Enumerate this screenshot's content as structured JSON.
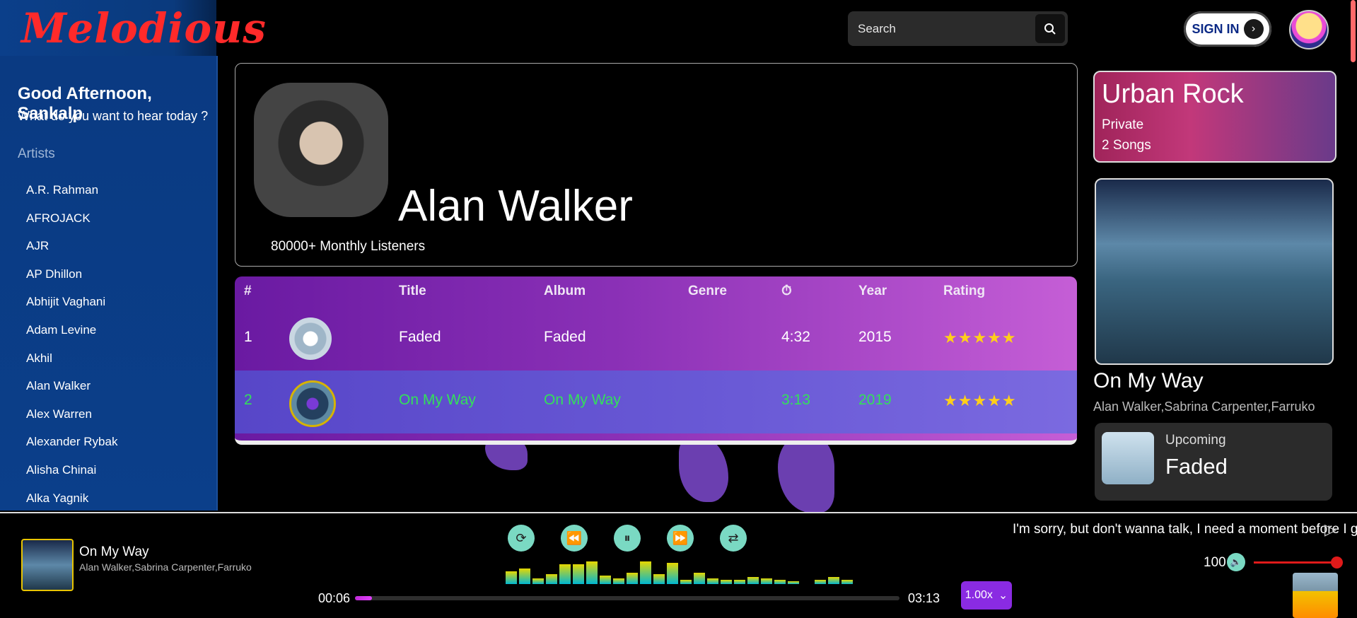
{
  "app": {
    "logo": "Melodious"
  },
  "header": {
    "search_placeholder": "Search",
    "signin_label": "SIGN IN"
  },
  "sidebar": {
    "greeting": "Good Afternoon, Sankalp",
    "subgreeting": "What do you want to hear today ?",
    "section_label": "Artists",
    "artists": [
      "A.R. Rahman",
      "AFROJACK",
      "AJR",
      "AP Dhillon",
      "Abhijit Vaghani",
      "Adam Levine",
      "Akhil",
      "Alan Walker",
      "Alex Warren",
      "Alexander Rybak",
      "Alisha Chinai",
      "Alka Yagnik"
    ]
  },
  "artist": {
    "name": "Alan Walker",
    "listeners": "80000+ Monthly Listeners"
  },
  "table": {
    "headers": {
      "num": "#",
      "title": "Title",
      "album": "Album",
      "genre": "Genre",
      "duration": "⏱",
      "year": "Year",
      "rating": "Rating"
    },
    "rows": [
      {
        "num": "1",
        "title": "Faded",
        "album": "Faded",
        "genre": "",
        "duration": "4:32",
        "year": "2015",
        "rating": 5
      },
      {
        "num": "2",
        "title": "On My Way",
        "album": "On My Way",
        "genre": "",
        "duration": "3:13",
        "year": "2019",
        "rating": 5
      }
    ]
  },
  "right": {
    "playlist": {
      "title": "Urban Rock",
      "visibility": "Private",
      "count": "2 Songs"
    },
    "now_playing": {
      "title": "On My Way",
      "artists": "Alan Walker,Sabrina Carpenter,Farruko"
    },
    "upcoming": {
      "label": "Upcoming",
      "title": "Faded"
    }
  },
  "player": {
    "title": "On My Way",
    "artists": "Alan Walker,Sabrina Carpenter,Farruko",
    "elapsed": "00:06",
    "total": "03:13",
    "progress": 0.031,
    "speed": "1.00x",
    "lyric": "I'm sorry, but don't wanna talk, I need a moment before I go",
    "volume": "100",
    "visualizer": [
      18,
      22,
      8,
      14,
      28,
      28,
      32,
      12,
      8,
      16,
      32,
      14,
      30,
      6,
      16,
      8,
      6,
      6,
      10,
      8,
      6,
      4,
      0,
      6,
      10,
      6
    ]
  },
  "colors": {
    "accent_green": "#33e05a",
    "star": "#ffcf1a",
    "control": "#7ad9c3",
    "logo_red": "#ff2a2a",
    "speed_purple": "#8a2be2",
    "volume_red": "#e01a1a"
  }
}
